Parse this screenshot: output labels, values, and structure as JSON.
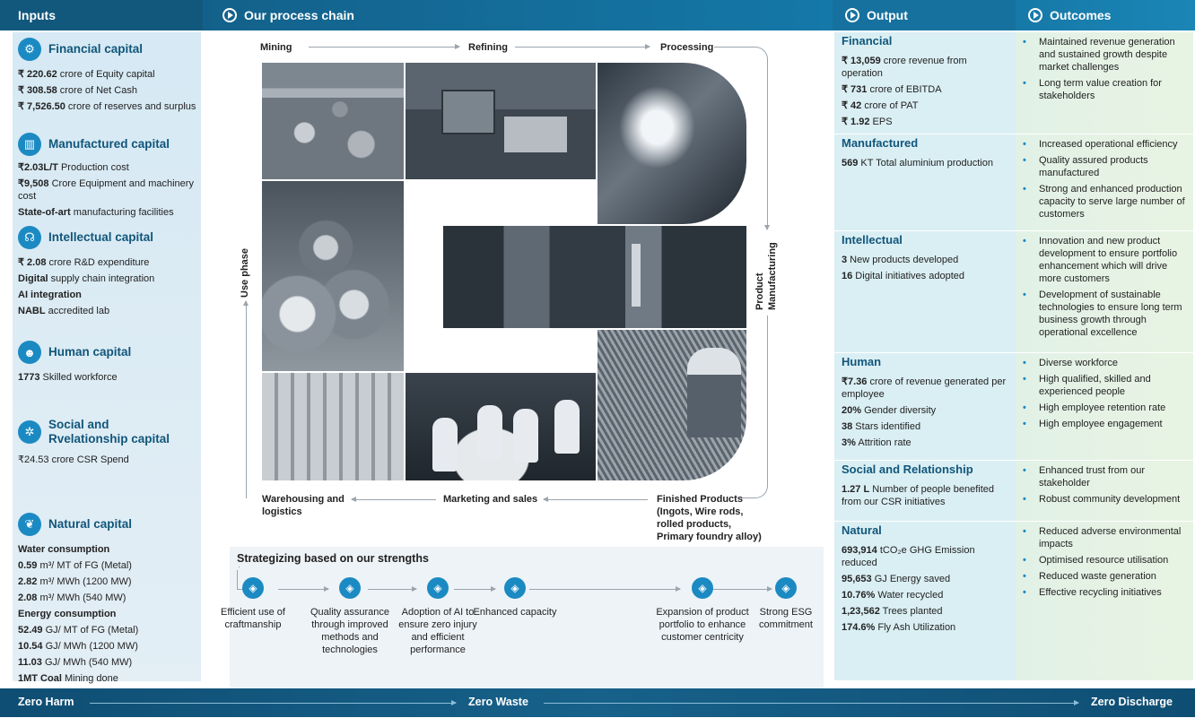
{
  "header": {
    "inputs": "Inputs",
    "process": "Our process chain",
    "output": "Output",
    "outcomes": "Outcomes"
  },
  "inputs": {
    "financial": {
      "title": "Financial capital",
      "lines": [
        {
          "b": "₹ 220.62",
          "t": " crore of Equity capital"
        },
        {
          "b": "₹ 308.58",
          "t": " crore of Net Cash"
        },
        {
          "b": "₹ 7,526.50",
          "t": " crore of reserves and surplus"
        }
      ]
    },
    "manufactured": {
      "title": "Manufactured capital",
      "lines": [
        {
          "b": "₹2.03L/T",
          "t": " Production cost"
        },
        {
          "b": "₹9,508",
          "t": " Crore Equipment and machinery cost"
        },
        {
          "b": "State-of-art",
          "t": " manufacturing facilities"
        }
      ]
    },
    "intellectual": {
      "title": "Intellectual capital",
      "lines": [
        {
          "b": "₹ 2.08",
          "t": " crore R&D expenditure"
        },
        {
          "b": "Digital",
          "t": " supply chain integration"
        },
        {
          "b": "AI integration",
          "t": ""
        },
        {
          "b": "NABL",
          "t": " accredited lab"
        }
      ]
    },
    "human": {
      "title": "Human capital",
      "lines": [
        {
          "b": "1773",
          "t": " Skilled workforce"
        }
      ]
    },
    "social": {
      "title_1": "Social and",
      "title_2": "Rvelationship capital",
      "lines": [
        {
          "b": "",
          "t": "₹24.53 crore CSR Spend"
        }
      ]
    },
    "natural": {
      "title": "Natural capital",
      "lines": [
        {
          "b": "Water consumption",
          "t": ""
        },
        {
          "b": "0.59",
          "t": " m³/ MT of FG (Metal)"
        },
        {
          "b": "2.82",
          "t": " m³/ MWh (1200 MW)"
        },
        {
          "b": "2.08",
          "t": " m³/ MWh (540 MW)"
        },
        {
          "b": "Energy consumption",
          "t": ""
        },
        {
          "b": "52.49",
          "t": " GJ/ MT of FG (Metal)"
        },
        {
          "b": "10.54",
          "t": " GJ/ MWh (1200 MW)"
        },
        {
          "b": "11.03",
          "t": " GJ/ MWh (540 MW)"
        },
        {
          "b": "1MT Coal",
          "t": "  Mining done"
        }
      ]
    }
  },
  "process": {
    "mining": "Mining",
    "refining": "Refining",
    "processing": "Processing",
    "product_manufacturing_1": "Product",
    "product_manufacturing_2": "Manufacturing",
    "finished_1": "Finished Products",
    "finished_2": "(Ingots, Wire rods,",
    "finished_3": "rolled products,",
    "finished_4": "Primary foundry alloy)",
    "marketing": "Marketing and sales",
    "warehousing_1": "Warehousing and",
    "warehousing_2": "logistics",
    "use_phase": "Use phase"
  },
  "strengths": {
    "title": "Strategizing based on our strengths",
    "items": [
      {
        "icon": "tools-icon",
        "label": "Efficient use of craftmanship"
      },
      {
        "icon": "gear-check-icon",
        "label": "Quality assurance through improved methods and technologies"
      },
      {
        "icon": "chip-icon",
        "label": "Adoption of AI to ensure zero injury and efficient performance"
      },
      {
        "icon": "hand-icon",
        "label": "Enhanced capacity"
      },
      {
        "icon": "portfolio-icon",
        "label": "Expansion of product portfolio to enhance customer centricity"
      },
      {
        "icon": "globe-icon",
        "label": "Strong ESG commitment"
      }
    ]
  },
  "output": {
    "financial": {
      "title": "Financial",
      "lines": [
        {
          "b": "₹ 13,059",
          "t": " crore revenue from operation"
        },
        {
          "b": "₹ 731",
          "t": " crore of EBITDA"
        },
        {
          "b": "₹ 42",
          "t": " crore of PAT"
        },
        {
          "b": "₹ 1.92",
          "t": " EPS"
        }
      ]
    },
    "manufactured": {
      "title": "Manufactured",
      "lines": [
        {
          "b": "569",
          "t": " KT Total aluminium production"
        }
      ]
    },
    "intellectual": {
      "title": "Intellectual",
      "lines": [
        {
          "b": "3",
          "t": "  New products developed"
        },
        {
          "b": "16",
          "t": "  Digital initiatives adopted"
        }
      ]
    },
    "human": {
      "title": "Human",
      "lines": [
        {
          "b": "₹7.36",
          "t": " crore of revenue generated per employee"
        },
        {
          "b": "20%",
          "t": " Gender diversity"
        },
        {
          "b": "38",
          "t": " Stars identified"
        },
        {
          "b": "3%",
          "t": " Attrition rate"
        }
      ]
    },
    "social": {
      "title": "Social and Relationship",
      "lines": [
        {
          "b": "1.27 L",
          "t": " Number of people benefited from our CSR initiatives"
        }
      ]
    },
    "natural": {
      "title": "Natural",
      "lines": [
        {
          "b": "693,914",
          "t": " tCO₂e GHG Emission reduced"
        },
        {
          "b": "95,653",
          "t": " GJ Energy saved"
        },
        {
          "b": "10.76%",
          "t": " Water recycled"
        },
        {
          "b": "1,23,562",
          "t": " Trees planted"
        },
        {
          "b": "174.6%",
          "t": " Fly Ash Utilization"
        }
      ]
    }
  },
  "outcomes": {
    "financial": [
      "Maintained revenue generation and sustained growth despite market challenges",
      "Long term value creation for stakeholders"
    ],
    "manufactured": [
      "Increased operational efficiency",
      "Quality assured products manufactured",
      "Strong and enhanced production capacity to serve large number of customers"
    ],
    "intellectual": [
      "Innovation and new product development to ensure portfolio enhancement which will drive more customers",
      "Development of sustainable technologies to ensure long term business growth through operational excellence"
    ],
    "human": [
      "Diverse workforce",
      "High qualified, skilled and experienced people",
      "High employee retention rate",
      "High employee engagement"
    ],
    "social": [
      "Enhanced trust from our stakeholder",
      "Robust community development"
    ],
    "natural": [
      "Reduced adverse environmental impacts",
      "Optimised resource utilisation",
      "Reduced waste generation",
      "Effective recycling initiatives"
    ]
  },
  "footer": {
    "left": "Zero Harm",
    "middle": "Zero Waste",
    "right": "Zero Discharge"
  }
}
